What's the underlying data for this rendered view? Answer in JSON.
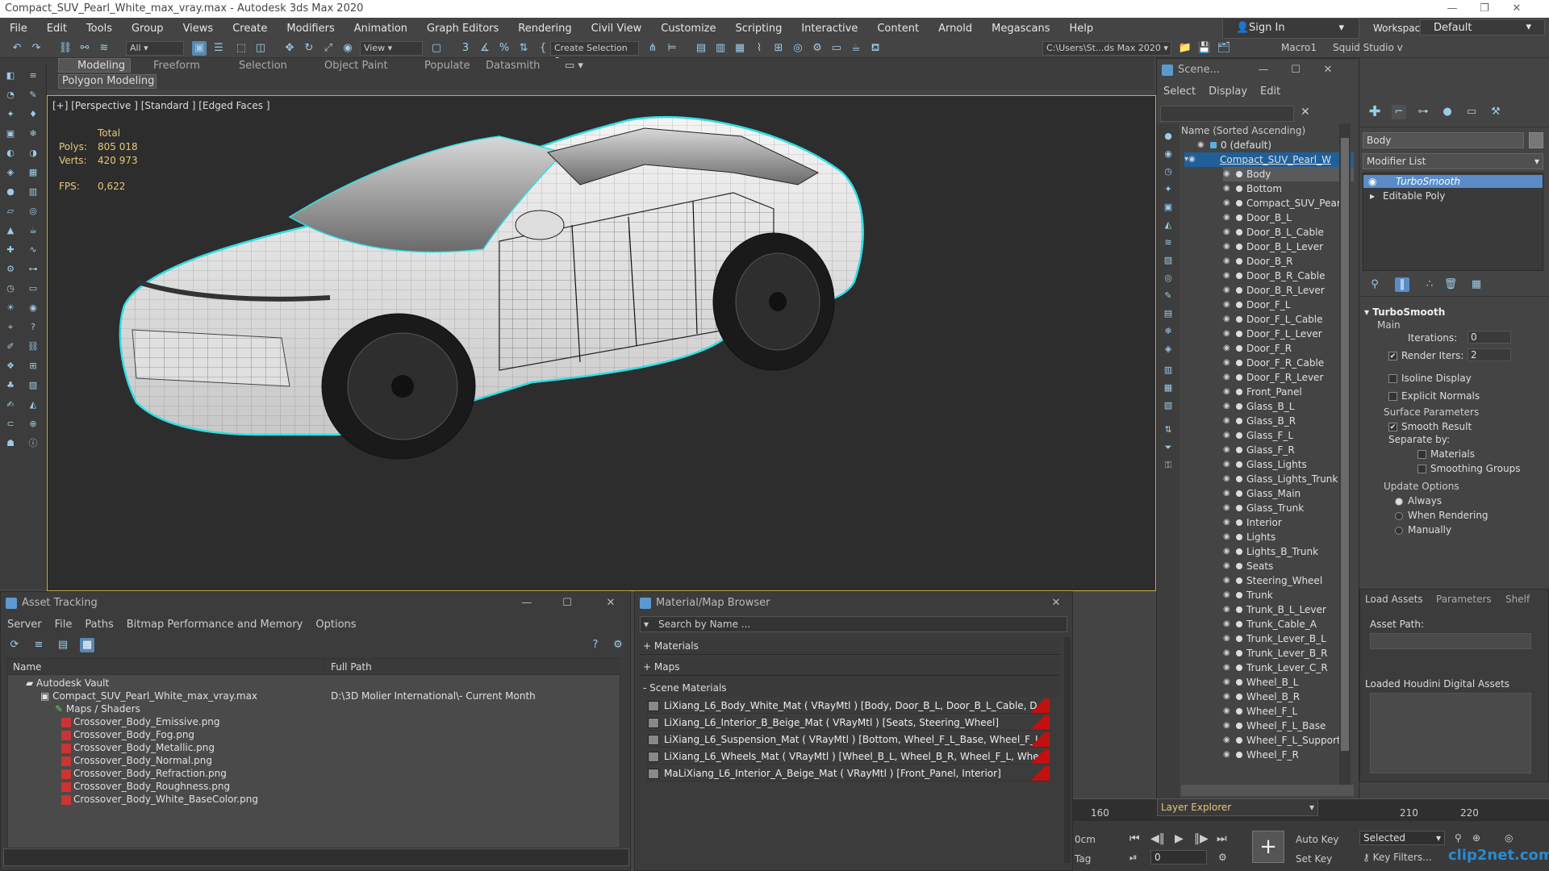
{
  "window": {
    "title": "Compact_SUV_Pearl_White_max_vray.max - Autodesk 3ds Max 2020"
  },
  "menu": [
    "File",
    "Edit",
    "Tools",
    "Group",
    "Views",
    "Create",
    "Modifiers",
    "Animation",
    "Graph Editors",
    "Rendering",
    "Civil View",
    "Customize",
    "Scripting",
    "Interactive",
    "Content",
    "Arnold",
    "Megascans",
    "Help"
  ],
  "account": {
    "sign_in": "Sign In",
    "workspaces_label": "Workspaces:",
    "workspace": "Default"
  },
  "toolbar": {
    "selection_filter": "All",
    "ref_coord": "View",
    "named_selection": "Create Selection Se",
    "project_path": "C:\\Users\\St...ds Max 2020",
    "macro": "Macro1",
    "squid": "Squid Studio v"
  },
  "ribbon": {
    "tabs": [
      "Modeling",
      "Freeform",
      "Selection",
      "Object Paint",
      "Populate",
      "Datasmith"
    ],
    "active": "Modeling",
    "sub": "Polygon Modeling"
  },
  "viewport": {
    "label": "[+] [Perspective ] [Standard ] [Edged Faces ]",
    "stats": {
      "total": "Total",
      "polys_label": "Polys:",
      "polys": "805 018",
      "verts_label": "Verts:",
      "verts": "420 973",
      "fps_label": "FPS:",
      "fps": "0,622"
    }
  },
  "scene_explorer": {
    "title": "Scene...",
    "menu": [
      "Select",
      "Display",
      "Edit"
    ],
    "column": "Name (Sorted Ascending)",
    "layer": "0 (default)",
    "root": "Compact_SUV_Pearl_W",
    "items": [
      "Body",
      "Bottom",
      "Compact_SUV_Pear",
      "Door_B_L",
      "Door_B_L_Cable",
      "Door_B_L_Lever",
      "Door_B_R",
      "Door_B_R_Cable",
      "Door_B_R_Lever",
      "Door_F_L",
      "Door_F_L_Cable",
      "Door_F_L_Lever",
      "Door_F_R",
      "Door_F_R_Cable",
      "Door_F_R_Lever",
      "Front_Panel",
      "Glass_B_L",
      "Glass_B_R",
      "Glass_F_L",
      "Glass_F_R",
      "Glass_Lights",
      "Glass_Lights_Trunk",
      "Glass_Main",
      "Glass_Trunk",
      "Interior",
      "Lights",
      "Lights_B_Trunk",
      "Seats",
      "Steering_Wheel",
      "Trunk",
      "Trunk_B_L_Lever",
      "Trunk_Cable_A",
      "Trunk_Lever_B_L",
      "Trunk_Lever_B_R",
      "Trunk_Lever_C_R",
      "Wheel_B_L",
      "Wheel_B_R",
      "Wheel_F_L",
      "Wheel_F_L_Base",
      "Wheel_F_L_Support",
      "Wheel_F_R"
    ],
    "footer": "Layer Explorer"
  },
  "command_panel": {
    "object_name": "Body",
    "modifier_list": "Modifier List",
    "stack": [
      "TurboSmooth",
      "Editable Poly"
    ],
    "rollout": "TurboSmooth",
    "main": "Main",
    "iterations_label": "Iterations:",
    "iterations": "0",
    "render_iters_label": "Render Iters:",
    "render_iters": "2",
    "isoline": "Isoline Display",
    "explicit": "Explicit Normals",
    "surface": "Surface Parameters",
    "smooth_result": "Smooth Result",
    "separate": "Separate by:",
    "materials": "Materials",
    "smoothing_groups": "Smoothing Groups",
    "update": "Update Options",
    "always": "Always",
    "when_rendering": "When Rendering",
    "manually": "Manually"
  },
  "houdini": {
    "tabs": [
      "Load Assets",
      "Parameters",
      "Shelf"
    ],
    "asset_path": "Asset Path:",
    "loaded": "Loaded Houdini Digital Assets"
  },
  "asset_tracking": {
    "title": "Asset Tracking",
    "menu": [
      "Server",
      "File",
      "Paths",
      "Bitmap Performance and Memory",
      "Options"
    ],
    "col_name": "Name",
    "col_path": "Full Path",
    "vault": "Autodesk Vault",
    "file": "Compact_SUV_Pearl_White_max_vray.max",
    "file_path": "D:\\3D Molier International\\- Current Month",
    "maps": "Maps / Shaders",
    "bitmaps": [
      "Crossover_Body_Emissive.png",
      "Crossover_Body_Fog.png",
      "Crossover_Body_Metallic.png",
      "Crossover_Body_Normal.png",
      "Crossover_Body_Refraction.png",
      "Crossover_Body_Roughness.png",
      "Crossover_Body_White_BaseColor.png"
    ]
  },
  "material_browser": {
    "title": "Material/Map Browser",
    "search": "Search by Name ...",
    "materials": "+ Materials",
    "maps": "+ Maps",
    "scene": "- Scene Materials",
    "items": [
      "LiXiang_L6_Body_White_Mat ( VRayMtl ) [Body, Door_B_L, Door_B_L_Cable, D...",
      "LiXiang_L6_Interior_B_Beige_Mat ( VRayMtl ) [Seats, Steering_Wheel]",
      "LiXiang_L6_Suspension_Mat ( VRayMtl ) [Bottom, Wheel_F_L_Base, Wheel_F_L...",
      "LiXiang_L6_Wheels_Mat ( VRayMtl ) [Wheel_B_L, Wheel_B_R, Wheel_F_L, Whe...",
      "MaLiXiang_L6_Interior_A_Beige_Mat ( VRayMtl ) [Front_Panel, Interior]"
    ]
  },
  "timeline": {
    "t160": "160",
    "t210": "210",
    "t220": "220",
    "auto_key": "Auto Key",
    "set_key": "Set Key",
    "selected": "Selected",
    "key_filters": "Key Filters...",
    "frame": "0",
    "ocm": "0cm",
    "tag": "Tag"
  },
  "watermark": "clip2net.com"
}
